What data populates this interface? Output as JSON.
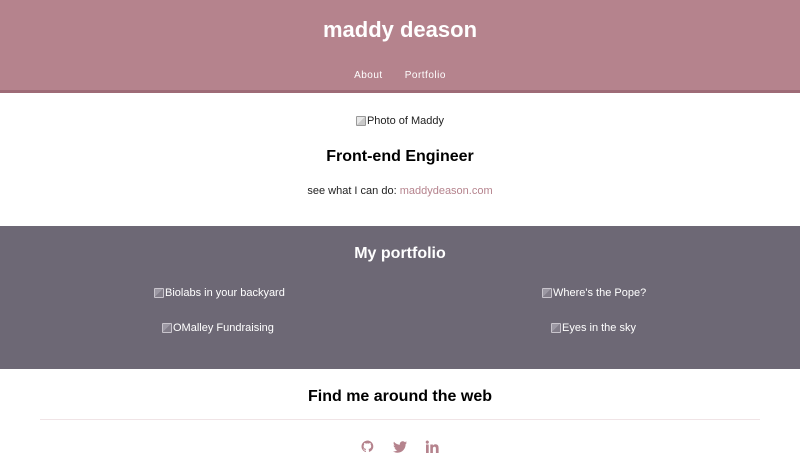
{
  "header": {
    "title": "maddy deason",
    "nav": [
      "About",
      "Portfolio"
    ]
  },
  "about": {
    "photo_alt": "Photo of Maddy",
    "role": "Front-end Engineer",
    "tagline_prefix": "see what I can do: ",
    "link_text": "maddydeason.com"
  },
  "portfolio": {
    "title": "My portfolio",
    "items": [
      "Biolabs in your backyard",
      "Where's the Pope?",
      "OMalley Fundraising",
      "Eyes in the sky"
    ]
  },
  "web": {
    "title": "Find me around the web",
    "icons": [
      "github-icon",
      "twitter-icon",
      "linkedin-icon"
    ]
  },
  "colors": {
    "header_bg": "#b5838d",
    "portfolio_bg": "#6d6875",
    "accent": "#b5838d"
  }
}
